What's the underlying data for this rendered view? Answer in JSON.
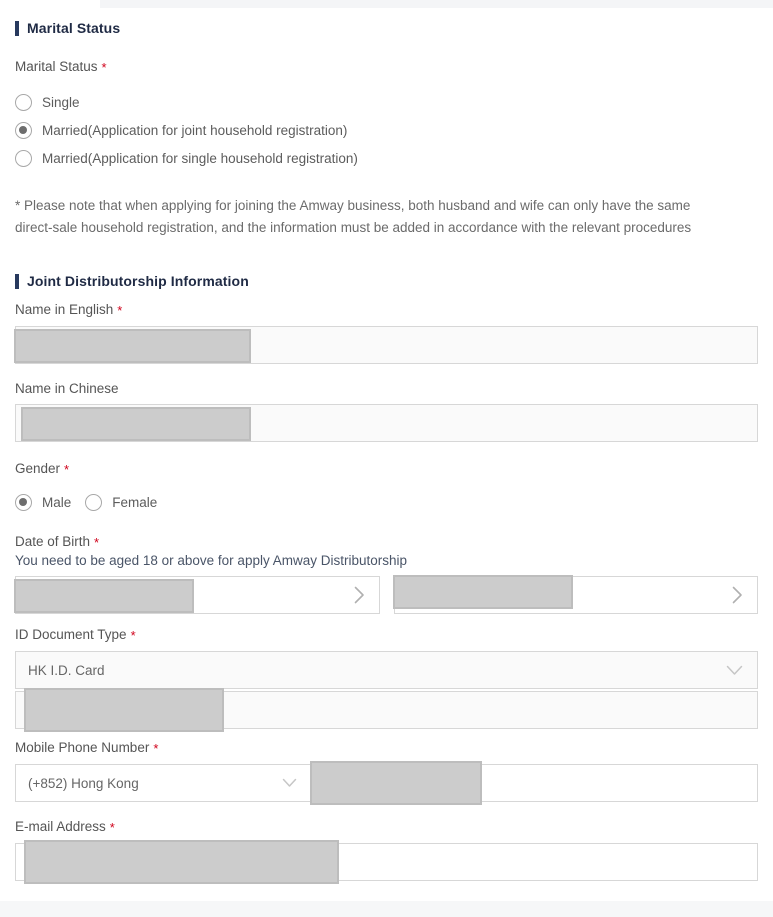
{
  "sections": {
    "marital": {
      "heading": "Marital Status",
      "field_label": "Marital Status",
      "required_mark": "*",
      "options": [
        {
          "label": "Single",
          "selected": false
        },
        {
          "label": "Married(Application for joint household registration)",
          "selected": true
        },
        {
          "label": "Married(Application for single household registration)",
          "selected": false
        }
      ],
      "note": "* Please note that when applying for joining the Amway business, both husband and wife can only have the same direct-sale household registration, and the information must be added in accordance with the relevant procedures"
    },
    "joint": {
      "heading": "Joint Distributorship Information",
      "name_english": {
        "label": "Name in English",
        "required_mark": "*",
        "value": ""
      },
      "name_chinese": {
        "label": "Name in Chinese",
        "required_mark": "",
        "value": ""
      },
      "gender": {
        "label": "Gender",
        "required_mark": "*",
        "options": [
          {
            "label": "Male",
            "selected": true
          },
          {
            "label": "Female",
            "selected": false
          }
        ]
      },
      "dob": {
        "label": "Date of Birth",
        "required_mark": "*",
        "hint": "You need to be aged 18 or above for apply Amway Distributorship",
        "first_value": "",
        "second_value": "",
        "chevron_icon": "chevron-right-icon"
      },
      "id_document": {
        "label": "ID Document Type",
        "required_mark": "*",
        "selected_value": "HK I.D. Card",
        "chevron_icon": "chevron-down-icon",
        "number_value": ""
      },
      "mobile": {
        "label": "Mobile Phone Number",
        "required_mark": "*",
        "country_code_value": "(+852)  Hong Kong",
        "chevron_icon": "chevron-down-icon",
        "number_value": ""
      },
      "email": {
        "label": "E-mail Address",
        "required_mark": "*",
        "value": ""
      }
    }
  },
  "colors": {
    "section_bar": "#28395e",
    "heading_text": "#1f2a44",
    "required": "#d0021b",
    "label_text": "#555555",
    "hint_text": "#4a5568",
    "mask": "#cccccc"
  }
}
